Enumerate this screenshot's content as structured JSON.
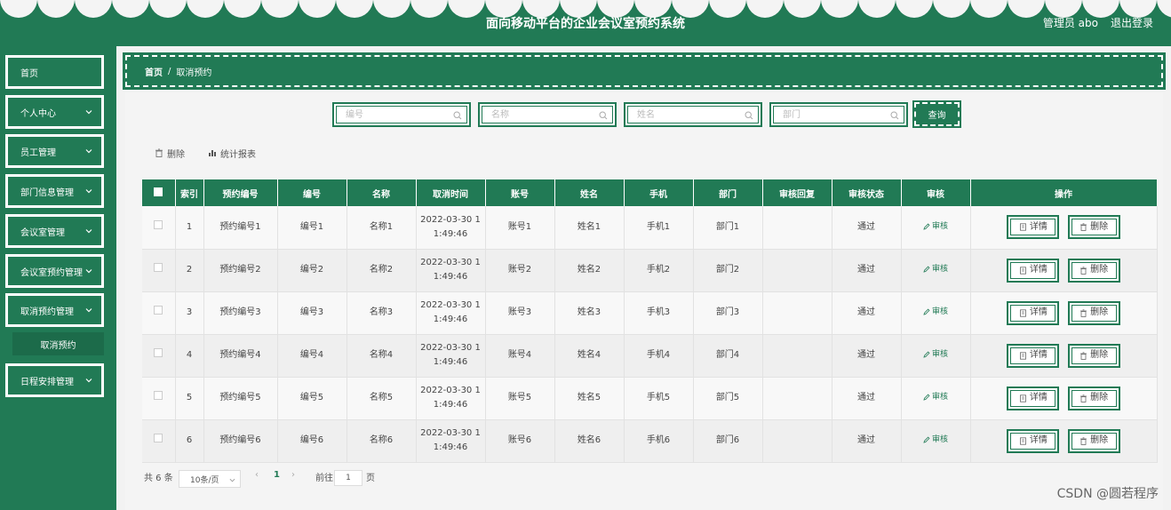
{
  "header": {
    "title": "面向移动平台的企业会议室预约系统",
    "user": "管理员 abo",
    "logout": "退出登录"
  },
  "sidebar": {
    "items": [
      {
        "label": "首页"
      },
      {
        "label": "个人中心"
      },
      {
        "label": "员工管理"
      },
      {
        "label": "部门信息管理"
      },
      {
        "label": "会议室管理"
      },
      {
        "label": "会议室预约管理"
      },
      {
        "label": "取消预约管理"
      },
      {
        "label": "日程安排管理"
      }
    ],
    "submenu": {
      "label": "取消预约"
    }
  },
  "breadcrumb": {
    "home": "首页",
    "separator": "/",
    "current": "取消预约"
  },
  "search": {
    "fields": [
      {
        "placeholder": "编号"
      },
      {
        "placeholder": "名称"
      },
      {
        "placeholder": "姓名"
      },
      {
        "placeholder": "部门"
      }
    ],
    "query_label": "查询"
  },
  "toolbar": {
    "delete_label": "删除",
    "report_label": "统计报表"
  },
  "table": {
    "headers": [
      "索引",
      "预约编号",
      "编号",
      "名称",
      "取消时间",
      "账号",
      "姓名",
      "手机",
      "部门",
      "审核回复",
      "审核状态",
      "审核",
      "操作"
    ],
    "rows": [
      {
        "index": "1",
        "booking_no": "预约编号1",
        "no": "编号1",
        "name": "名称1",
        "time_a": "2022-03-30 1",
        "time_b": "1:49:46",
        "account": "账号1",
        "person": "姓名1",
        "phone": "手机1",
        "dept": "部门1",
        "reply": "",
        "status": "通过"
      },
      {
        "index": "2",
        "booking_no": "预约编号2",
        "no": "编号2",
        "name": "名称2",
        "time_a": "2022-03-30 1",
        "time_b": "1:49:46",
        "account": "账号2",
        "person": "姓名2",
        "phone": "手机2",
        "dept": "部门2",
        "reply": "",
        "status": "通过"
      },
      {
        "index": "3",
        "booking_no": "预约编号3",
        "no": "编号3",
        "name": "名称3",
        "time_a": "2022-03-30 1",
        "time_b": "1:49:46",
        "account": "账号3",
        "person": "姓名3",
        "phone": "手机3",
        "dept": "部门3",
        "reply": "",
        "status": "通过"
      },
      {
        "index": "4",
        "booking_no": "预约编号4",
        "no": "编号4",
        "name": "名称4",
        "time_a": "2022-03-30 1",
        "time_b": "1:49:46",
        "account": "账号4",
        "person": "姓名4",
        "phone": "手机4",
        "dept": "部门4",
        "reply": "",
        "status": "通过"
      },
      {
        "index": "5",
        "booking_no": "预约编号5",
        "no": "编号5",
        "name": "名称5",
        "time_a": "2022-03-30 1",
        "time_b": "1:49:46",
        "account": "账号5",
        "person": "姓名5",
        "phone": "手机5",
        "dept": "部门5",
        "reply": "",
        "status": "通过"
      },
      {
        "index": "6",
        "booking_no": "预约编号6",
        "no": "编号6",
        "name": "名称6",
        "time_a": "2022-03-30 1",
        "time_b": "1:49:46",
        "account": "账号6",
        "person": "姓名6",
        "phone": "手机6",
        "dept": "部门6",
        "reply": "",
        "status": "通过"
      }
    ],
    "audit_label": "审核",
    "detail_label": "详情",
    "delete_label": "删除"
  },
  "pagination": {
    "total": "共 6 条",
    "page_size": "10条/页",
    "prev": "‹",
    "current": "1",
    "next": "›",
    "goto": "前往",
    "goto_value": "1",
    "page_unit": "页"
  },
  "watermark": "CSDN @圆若程序",
  "colors": {
    "primary": "#217a55",
    "background": "#f4f4f4"
  },
  "icons": {
    "search": "search-icon",
    "chevron": "chevron-down-icon",
    "delete": "trash-icon",
    "report": "bar-chart-icon",
    "audit": "edit-icon",
    "detail": "document-icon"
  }
}
